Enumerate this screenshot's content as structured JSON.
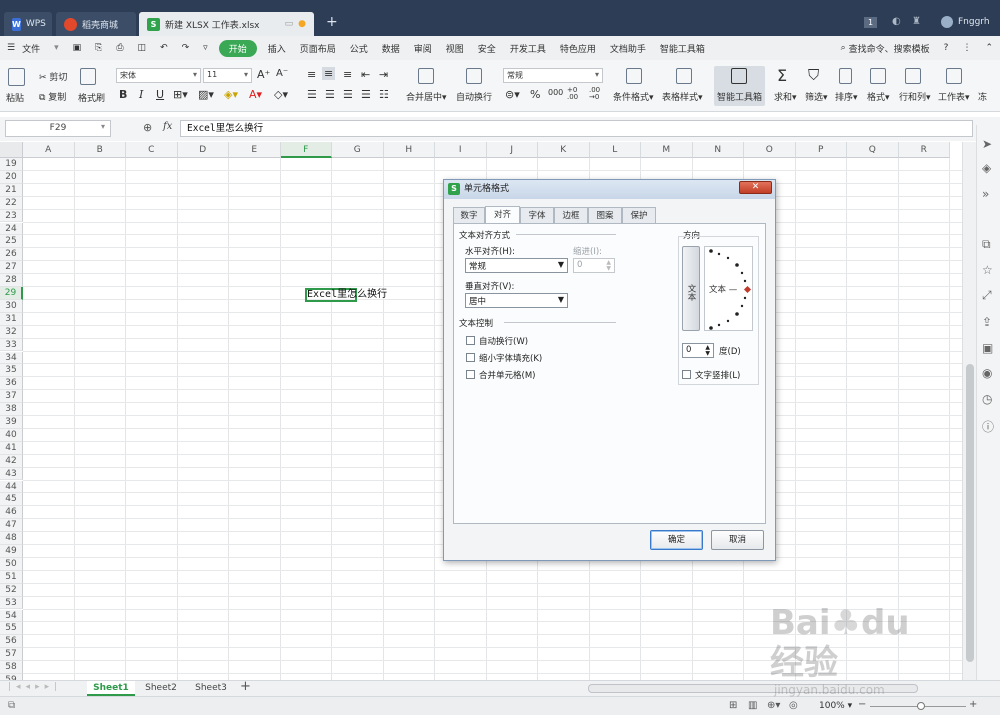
{
  "titlebar": {
    "tabs": [
      {
        "label": "WPS"
      },
      {
        "label": "稻壳商城"
      },
      {
        "label": "新建 XLSX 工作表.xlsx"
      }
    ],
    "page_num": "1",
    "user": "Fnggrh"
  },
  "menu": {
    "file": "文件",
    "items": [
      "开始",
      "插入",
      "页面布局",
      "公式",
      "数据",
      "审阅",
      "视图",
      "安全",
      "开发工具",
      "特色应用",
      "文档助手",
      "智能工具箱"
    ],
    "search": "查找命令、搜索模板"
  },
  "ribbon": {
    "paste": "粘贴",
    "cut": "剪切",
    "copy": "复制",
    "format_painter": "格式刷",
    "font_name": "宋体",
    "font_size": "11",
    "merge_center": "合并居中",
    "wrap_text": "自动换行",
    "number_format": "常规",
    "conditional_format": "条件格式",
    "table_style": "表格样式",
    "smart_toolbox": "智能工具箱",
    "sum": "求和",
    "filter": "筛选",
    "sort": "排序",
    "format": "格式",
    "rows_cols": "行和列",
    "worksheet": "工作表",
    "freeze": "冻"
  },
  "formula_bar": {
    "name_box": "F29",
    "fx": "fx",
    "content": "Excel里怎么换行"
  },
  "grid": {
    "columns": [
      "A",
      "B",
      "C",
      "D",
      "E",
      "F",
      "G",
      "H",
      "I",
      "J",
      "K",
      "L",
      "M",
      "N",
      "O",
      "P",
      "Q",
      "R"
    ],
    "rows": [
      "19",
      "20",
      "21",
      "22",
      "23",
      "24",
      "25",
      "26",
      "27",
      "28",
      "29",
      "30",
      "31",
      "32",
      "33",
      "34",
      "35",
      "36",
      "37",
      "38",
      "39",
      "40",
      "41",
      "42",
      "43",
      "44",
      "45",
      "46",
      "47",
      "48",
      "49",
      "50",
      "51",
      "52",
      "53",
      "54",
      "55",
      "56",
      "57",
      "58",
      "59"
    ],
    "cell_text": "Excel里怎么换行"
  },
  "dialog": {
    "title": "单元格格式",
    "tabs": [
      "数字",
      "对齐",
      "字体",
      "边框",
      "图案",
      "保护"
    ],
    "section_align": "文本对齐方式",
    "horizontal_label": "水平对齐(H):",
    "horizontal_value": "常规",
    "indent_label": "缩进(I):",
    "indent_value": "0",
    "vertical_label": "垂直对齐(V):",
    "vertical_value": "居中",
    "section_control": "文本控制",
    "wrap_label": "自动换行(W)",
    "shrink_label": "缩小字体填充(K)",
    "merge_label": "合并单元格(M)",
    "orientation_label": "方向",
    "vertical_text": "文本",
    "orientation_text": "文本 —",
    "degrees_value": "0",
    "degrees_label": "度(D)",
    "stack_label": "文字竖排(L)",
    "ok": "确定",
    "cancel": "取消"
  },
  "sheets": [
    "Sheet1",
    "Sheet2",
    "Sheet3"
  ],
  "status": {
    "zoom": "100%"
  },
  "watermark": "Baidu经验 jingyan.baidu.com"
}
